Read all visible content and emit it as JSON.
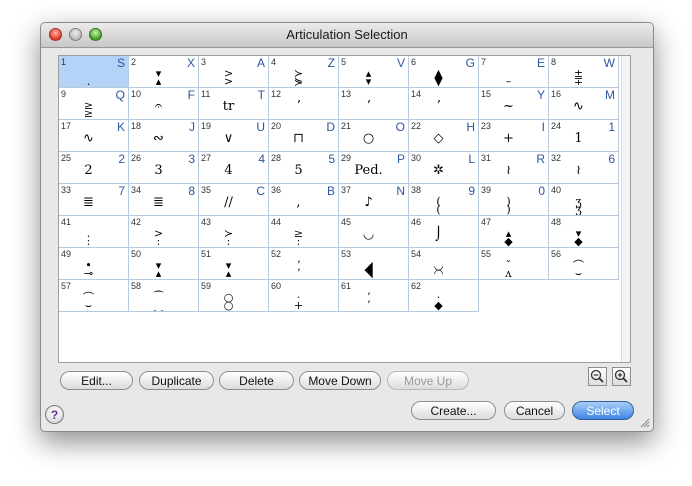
{
  "window": {
    "title": "Articulation Selection"
  },
  "selected_index": 0,
  "cells": [
    {
      "n": "1",
      "k": "S",
      "s": [
        "",
        ".",
        ""
      ]
    },
    {
      "n": "2",
      "k": "X",
      "s": [
        "▾",
        "▴",
        ""
      ]
    },
    {
      "n": "3",
      "k": "A",
      "s": [
        ">",
        ">",
        ""
      ]
    },
    {
      "n": "4",
      "k": "Z",
      "s": [
        "≻",
        "⋟",
        ""
      ]
    },
    {
      "n": "5",
      "k": "V",
      "s": [
        "▴",
        "▾",
        ""
      ]
    },
    {
      "n": "6",
      "k": "G",
      "s": [
        "▲",
        "▼",
        ""
      ]
    },
    {
      "n": "7",
      "k": "E",
      "s": [
        "",
        "–",
        ""
      ]
    },
    {
      "n": "8",
      "k": "W",
      "s": [
        "±",
        "∓",
        ""
      ]
    },
    {
      "n": "9",
      "k": "Q",
      "s": [
        "≥",
        "≥",
        ""
      ]
    },
    {
      "n": "10",
      "k": "F",
      "s": [
        "",
        "",
        "𝄐"
      ]
    },
    {
      "n": "11",
      "k": "T",
      "s": [
        "",
        "",
        "tr"
      ]
    },
    {
      "n": "12",
      "k": "",
      "s": [
        "",
        "",
        "ʼ"
      ]
    },
    {
      "n": "13",
      "k": "",
      "s": [
        "",
        "",
        "ʼ"
      ]
    },
    {
      "n": "14",
      "k": "",
      "s": [
        "",
        "",
        "ʼ"
      ]
    },
    {
      "n": "15",
      "k": "Y",
      "s": [
        "",
        "",
        "~"
      ]
    },
    {
      "n": "16",
      "k": "M",
      "s": [
        "",
        "",
        "∿"
      ]
    },
    {
      "n": "17",
      "k": "K",
      "s": [
        "",
        "",
        "∿"
      ]
    },
    {
      "n": "18",
      "k": "J",
      "s": [
        "",
        "",
        "∾"
      ]
    },
    {
      "n": "19",
      "k": "U",
      "s": [
        "",
        "",
        "∨"
      ]
    },
    {
      "n": "20",
      "k": "D",
      "s": [
        "",
        "",
        "⊓"
      ]
    },
    {
      "n": "21",
      "k": "O",
      "s": [
        "",
        "",
        "○"
      ]
    },
    {
      "n": "22",
      "k": "H",
      "s": [
        "",
        "",
        "◇"
      ]
    },
    {
      "n": "23",
      "k": "I",
      "s": [
        "",
        "",
        "+"
      ]
    },
    {
      "n": "24",
      "k": "1",
      "s": [
        "",
        "",
        "1"
      ]
    },
    {
      "n": "25",
      "k": "2",
      "s": [
        "",
        "",
        "2"
      ]
    },
    {
      "n": "26",
      "k": "3",
      "s": [
        "",
        "",
        "3"
      ]
    },
    {
      "n": "27",
      "k": "4",
      "s": [
        "",
        "",
        "4"
      ]
    },
    {
      "n": "28",
      "k": "5",
      "s": [
        "",
        "",
        "5"
      ]
    },
    {
      "n": "29",
      "k": "P",
      "s": [
        "",
        "",
        "Ped."
      ]
    },
    {
      "n": "30",
      "k": "L",
      "s": [
        "",
        "",
        "✲"
      ]
    },
    {
      "n": "31",
      "k": "R",
      "s": [
        "",
        "",
        "≀"
      ]
    },
    {
      "n": "32",
      "k": "6",
      "s": [
        "",
        "",
        "≀"
      ]
    },
    {
      "n": "33",
      "k": "7",
      "s": [
        "",
        "",
        "≣"
      ]
    },
    {
      "n": "34",
      "k": "8",
      "s": [
        "",
        "",
        "≣"
      ]
    },
    {
      "n": "35",
      "k": "C",
      "s": [
        "",
        "",
        "//"
      ]
    },
    {
      "n": "36",
      "k": "B",
      "s": [
        "",
        "",
        ","
      ]
    },
    {
      "n": "37",
      "k": "N",
      "s": [
        "",
        "",
        "♪"
      ]
    },
    {
      "n": "38",
      "k": "9",
      "s": [
        "(",
        "(",
        ""
      ]
    },
    {
      "n": "39",
      "k": "0",
      "s": [
        ")",
        ")",
        ""
      ]
    },
    {
      "n": "40",
      "k": "",
      "s": [
        "ʒ",
        "ʒ",
        ""
      ]
    },
    {
      "n": "41",
      "k": "",
      "s": [
        ".",
        ":",
        ""
      ]
    },
    {
      "n": "42",
      "k": "",
      "s": [
        ">",
        ":",
        ""
      ]
    },
    {
      "n": "43",
      "k": "",
      "s": [
        "≻",
        ":",
        ""
      ]
    },
    {
      "n": "44",
      "k": "",
      "s": [
        "≥",
        ":",
        ""
      ]
    },
    {
      "n": "45",
      "k": "",
      "s": [
        "",
        "",
        "◡"
      ]
    },
    {
      "n": "46",
      "k": "",
      "s": [
        "",
        "",
        "⌡"
      ]
    },
    {
      "n": "47",
      "k": "",
      "s": [
        "▴",
        "◆",
        ""
      ]
    },
    {
      "n": "48",
      "k": "",
      "s": [
        "▾",
        "◆",
        ""
      ]
    },
    {
      "n": "49",
      "k": "",
      "s": [
        "•",
        "⊸",
        ""
      ]
    },
    {
      "n": "50",
      "k": "",
      "s": [
        "▾",
        "▴",
        ""
      ]
    },
    {
      "n": "51",
      "k": "",
      "s": [
        "▾",
        "▴",
        ""
      ]
    },
    {
      "n": "52",
      "k": "",
      "s": [
        "ʼ",
        "ʼ",
        ""
      ]
    },
    {
      "n": "53",
      "k": "",
      "s": [
        "◢",
        "◥",
        ""
      ]
    },
    {
      "n": "54",
      "k": "",
      "s": [
        "◡",
        "◠",
        ""
      ]
    },
    {
      "n": "55",
      "k": "",
      "s": [
        "ˇ",
        "ʌ",
        ""
      ]
    },
    {
      "n": "56",
      "k": "",
      "s": [
        "⌒",
        "⌣",
        ""
      ]
    },
    {
      "n": "57",
      "k": "",
      "s": [
        "⌒",
        "⌣",
        ""
      ]
    },
    {
      "n": "58",
      "k": "",
      "s": [
        "⁀",
        "‿",
        ""
      ]
    },
    {
      "n": "59",
      "k": "",
      "s": [
        "○",
        "○",
        ""
      ]
    },
    {
      "n": "60",
      "k": "",
      "s": [
        "·",
        "+",
        ""
      ]
    },
    {
      "n": "61",
      "k": "",
      "s": [
        "ʼ",
        "ʼ",
        ""
      ]
    },
    {
      "n": "62",
      "k": "",
      "s": [
        "·",
        "◆",
        ""
      ]
    }
  ],
  "toolbar": {
    "edit": "Edit...",
    "duplicate": "Duplicate",
    "delete": "Delete",
    "move_down": "Move Down",
    "move_up": "Move Up"
  },
  "footer": {
    "help": "?",
    "create": "Create...",
    "cancel": "Cancel",
    "select": "Select"
  },
  "icons": {
    "zoom_out": "zoom-out-icon",
    "zoom_in": "zoom-in-icon"
  },
  "colors": {
    "selection": "#b5d3f7",
    "key_letter": "#2c56a0",
    "default_button": "#3f86e3",
    "grid_line": "#b7c9dd"
  }
}
